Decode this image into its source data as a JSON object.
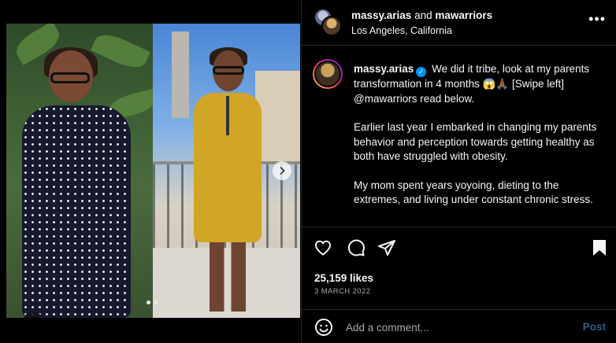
{
  "header": {
    "username": "massy.arias",
    "and_text": "and",
    "collaborator": "mawarriors",
    "location": "Los Angeles, California",
    "more_icon": "more-horizontal-icon",
    "more_glyph": "•••"
  },
  "media": {
    "next_icon": "chevron-right-icon",
    "tag_icon": "user-tag-icon",
    "slide_count": 2,
    "active_slide": 1
  },
  "caption": {
    "username": "massy.arias",
    "verified_icon": "verified-badge-icon",
    "line1": "We did it tribe, look at my parents transformation in 4 months 😱🙏🏾 [Swipe left] @mawarriors read below.",
    "para2": "Earlier last year I embarked in changing my parents behavior and perception towards getting healthy as both have struggled with obesity.",
    "para3": "My mom spent years yoyoing, dieting to the extremes, and living under constant chronic stress."
  },
  "actions": {
    "like_icon": "heart-icon",
    "comment_icon": "comment-icon",
    "share_icon": "share-icon",
    "save_icon": "bookmark-icon"
  },
  "stats": {
    "likes": "25,159 likes",
    "date": "3 MARCH 2022"
  },
  "comment": {
    "emoji_icon": "emoji-icon",
    "placeholder": "Add a comment...",
    "post_label": "Post"
  },
  "colors": {
    "background": "#000000",
    "text": "#f5f5f5",
    "muted": "#a8a8a8",
    "verified": "#0095f6",
    "post_disabled": "#2d5f89",
    "divider": "#262626"
  }
}
